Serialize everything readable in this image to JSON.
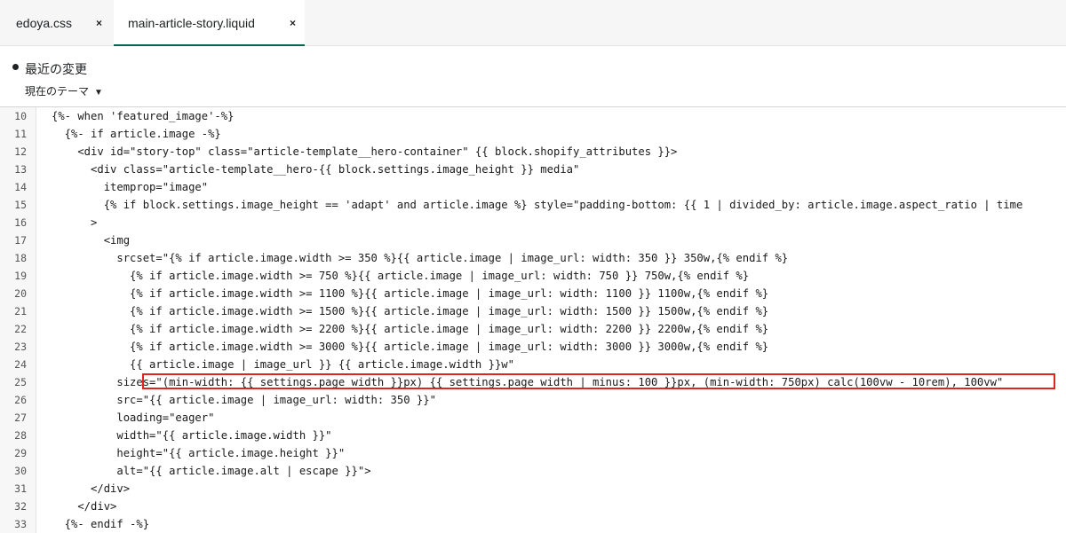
{
  "tabs": [
    {
      "label": "edoya.css",
      "close": "×"
    },
    {
      "label": "main-article-story.liquid",
      "close": "×"
    }
  ],
  "changes": {
    "title": "最近の変更",
    "theme_label": "現在のテーマ"
  },
  "code_lines": [
    {
      "n": "10",
      "text": "{%- when 'featured_image'-%}"
    },
    {
      "n": "11",
      "text": "  {%- if article.image -%}"
    },
    {
      "n": "12",
      "text": "    <div id=\"story-top\" class=\"article-template__hero-container\" {{ block.shopify_attributes }}>"
    },
    {
      "n": "13",
      "text": "      <div class=\"article-template__hero-{{ block.settings.image_height }} media\""
    },
    {
      "n": "14",
      "text": "        itemprop=\"image\""
    },
    {
      "n": "15",
      "text": "        {% if block.settings.image_height == 'adapt' and article.image %} style=\"padding-bottom: {{ 1 | divided_by: article.image.aspect_ratio | time"
    },
    {
      "n": "16",
      "text": "      >"
    },
    {
      "n": "17",
      "text": "        <img"
    },
    {
      "n": "18",
      "text": "          srcset=\"{% if article.image.width >= 350 %}{{ article.image | image_url: width: 350 }} 350w,{% endif %}"
    },
    {
      "n": "19",
      "text": "            {% if article.image.width >= 750 %}{{ article.image | image_url: width: 750 }} 750w,{% endif %}"
    },
    {
      "n": "20",
      "text": "            {% if article.image.width >= 1100 %}{{ article.image | image_url: width: 1100 }} 1100w,{% endif %}"
    },
    {
      "n": "21",
      "text": "            {% if article.image.width >= 1500 %}{{ article.image | image_url: width: 1500 }} 1500w,{% endif %}"
    },
    {
      "n": "22",
      "text": "            {% if article.image.width >= 2200 %}{{ article.image | image_url: width: 2200 }} 2200w,{% endif %}"
    },
    {
      "n": "23",
      "text": "            {% if article.image.width >= 3000 %}{{ article.image | image_url: width: 3000 }} 3000w,{% endif %}"
    },
    {
      "n": "24",
      "text": "            {{ article.image | image_url }} {{ article.image.width }}w\""
    },
    {
      "n": "25",
      "text": "          sizes=\"(min-width: {{ settings.page_width }}px) {{ settings.page_width | minus: 100 }}px, (min-width: 750px) calc(100vw - 10rem), 100vw\""
    },
    {
      "n": "26",
      "text": "          src=\"{{ article.image | image_url: width: 350 }}\""
    },
    {
      "n": "27",
      "text": "          loading=\"eager\""
    },
    {
      "n": "28",
      "text": "          width=\"{{ article.image.width }}\""
    },
    {
      "n": "29",
      "text": "          height=\"{{ article.image.height }}\""
    },
    {
      "n": "30",
      "text": "          alt=\"{{ article.image.alt | escape }}\">"
    },
    {
      "n": "31",
      "text": "      </div>"
    },
    {
      "n": "32",
      "text": "    </div>"
    },
    {
      "n": "33",
      "text": "  {%- endif -%}"
    }
  ],
  "highlighted_line": "25",
  "colors": {
    "accent": "#00664f",
    "highlight_border": "#e02424"
  }
}
